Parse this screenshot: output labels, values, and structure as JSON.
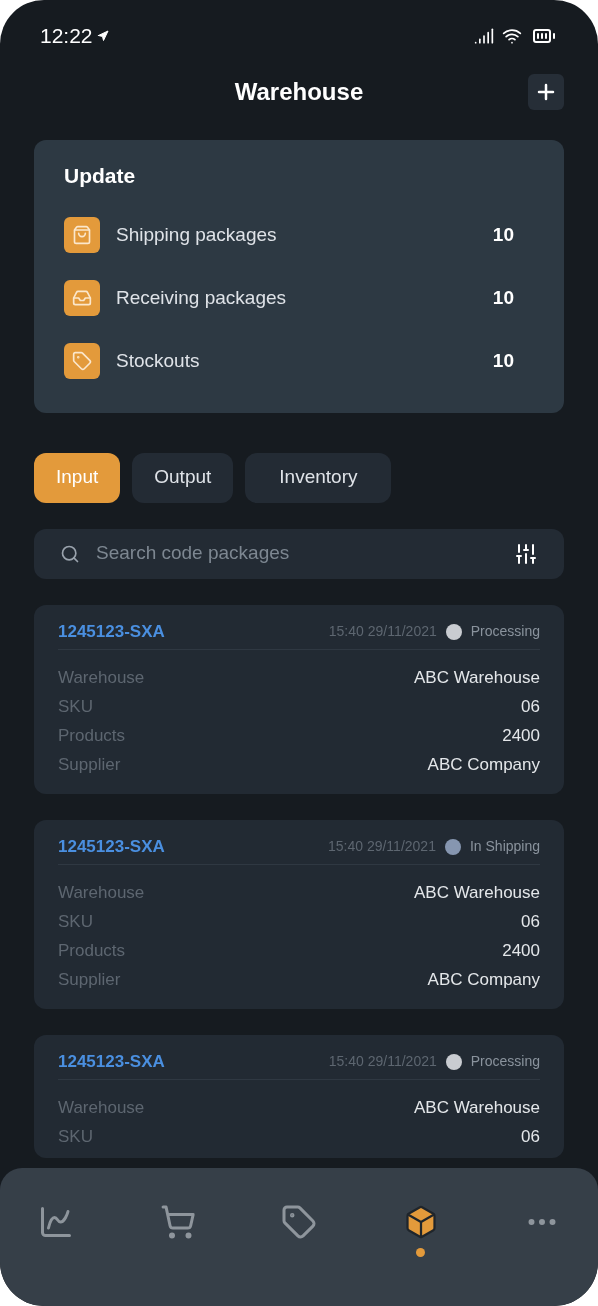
{
  "status_bar": {
    "time": "12:22"
  },
  "header": {
    "title": "Warehouse"
  },
  "update": {
    "title": "Update",
    "items": [
      {
        "kind": "shipping",
        "label": "Shipping packages",
        "count": "10"
      },
      {
        "kind": "receiving",
        "label": "Receiving packages",
        "count": "10"
      },
      {
        "kind": "stockouts",
        "label": "Stockouts",
        "count": "10"
      }
    ]
  },
  "tabs": [
    {
      "label": "Input",
      "selected": true
    },
    {
      "label": "Output",
      "selected": false
    },
    {
      "label": "Inventory",
      "selected": false
    }
  ],
  "search": {
    "placeholder": "Search code packages"
  },
  "orders": [
    {
      "code": "1245123-SXA",
      "datetime": "15:40 29/11/2021",
      "status": "Processing",
      "color": "#c9ccd1",
      "fields": [
        {
          "label": "Warehouse",
          "value": "ABC Warehouse"
        },
        {
          "label": "SKU",
          "value": "06"
        },
        {
          "label": "Products",
          "value": "2400"
        },
        {
          "label": "Supplier",
          "value": "ABC Company"
        }
      ]
    },
    {
      "code": "1245123-SXA",
      "datetime": "15:40 29/11/2021",
      "status": "In Shipping",
      "color": "#8696b0",
      "fields": [
        {
          "label": "Warehouse",
          "value": "ABC Warehouse"
        },
        {
          "label": "SKU",
          "value": "06"
        },
        {
          "label": "Products",
          "value": "2400"
        },
        {
          "label": "Supplier",
          "value": "ABC Company"
        }
      ]
    },
    {
      "code": "1245123-SXA",
      "datetime": "15:40 29/11/2021",
      "status": "Processing",
      "color": "#c9ccd1",
      "fields": [
        {
          "label": "Warehouse",
          "value": "ABC Warehouse"
        },
        {
          "label": "SKU",
          "value": "06"
        }
      ]
    }
  ],
  "nav": [
    {
      "kind": "chart",
      "selected": false
    },
    {
      "kind": "cart",
      "selected": false
    },
    {
      "kind": "tag",
      "selected": false
    },
    {
      "kind": "box",
      "selected": true
    },
    {
      "kind": "more",
      "selected": false
    }
  ]
}
